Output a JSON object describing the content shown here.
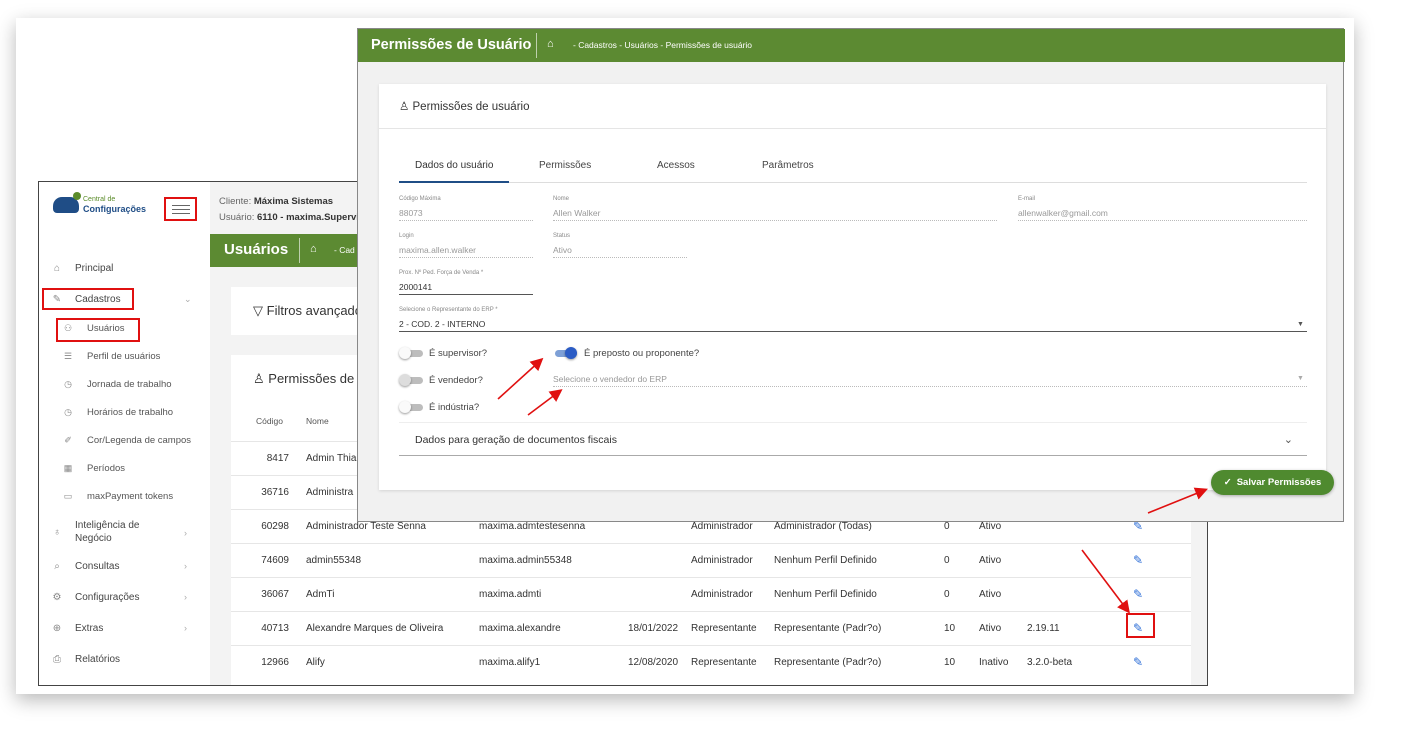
{
  "colors": {
    "green": "#5c8a32",
    "red_highlight": "#e01010",
    "toggle_on": "#2b5cc5",
    "save_button": "#4f8a2f",
    "edit_icon": "#2b6cd6"
  },
  "logo": {
    "small": "Central de",
    "big": "Configurações"
  },
  "client": {
    "client_label": "Cliente:",
    "client_value": "Máxima Sistemas",
    "user_label": "Usuário:",
    "user_value": "6110 - maxima.Supervis"
  },
  "bg_header": {
    "title": "Usuários",
    "breadcrumb": "- Cad"
  },
  "sidebar": {
    "items": [
      {
        "label": "Principal",
        "icon": "home-icon"
      },
      {
        "label": "Cadastros",
        "icon": "edit-note-icon"
      },
      {
        "label": "Inteligência de Negócio",
        "icon": "lightbulb-icon"
      },
      {
        "label": "Consultas",
        "icon": "search-icon"
      },
      {
        "label": "Configurações",
        "icon": "gear-icon"
      },
      {
        "label": "Extras",
        "icon": "plus-circle-icon"
      },
      {
        "label": "Relatórios",
        "icon": "printer-icon"
      }
    ],
    "sub_items": [
      {
        "label": "Usuários",
        "icon": "users-icon"
      },
      {
        "label": "Perfil de usuários",
        "icon": "list-icon"
      },
      {
        "label": "Jornada de trabalho",
        "icon": "clock-icon"
      },
      {
        "label": "Horários de trabalho",
        "icon": "clock-icon"
      },
      {
        "label": "Cor/Legenda de campos",
        "icon": "pen-icon"
      },
      {
        "label": "Períodos",
        "icon": "calendar-icon"
      },
      {
        "label": "maxPayment tokens",
        "icon": "card-icon"
      }
    ]
  },
  "filters": {
    "title": "Filtros avançado"
  },
  "perms_panel": {
    "title": "Permissões de u"
  },
  "table": {
    "headers": {
      "code": "Código",
      "name": "Nome"
    },
    "rows": [
      {
        "code": "8417",
        "name": "Admin Thia",
        "login": "",
        "date": "",
        "type": "",
        "profile": "",
        "n": "",
        "status": "",
        "version": ""
      },
      {
        "code": "36716",
        "name": "Administra",
        "login": "",
        "date": "",
        "type": "",
        "profile": "",
        "n": "",
        "status": "",
        "version": ""
      },
      {
        "code": "60298",
        "name": "Administrador Teste Senna",
        "login": "maxima.admtestesenna",
        "date": "",
        "type": "Administrador",
        "profile": "Administrador (Todas)",
        "n": "0",
        "status": "Ativo",
        "version": ""
      },
      {
        "code": "74609",
        "name": "admin55348",
        "login": "maxima.admin55348",
        "date": "",
        "type": "Administrador",
        "profile": "Nenhum Perfil Definido",
        "n": "0",
        "status": "Ativo",
        "version": ""
      },
      {
        "code": "36067",
        "name": "AdmTi",
        "login": "maxima.admti",
        "date": "",
        "type": "Administrador",
        "profile": "Nenhum Perfil Definido",
        "n": "0",
        "status": "Ativo",
        "version": ""
      },
      {
        "code": "40713",
        "name": "Alexandre Marques de Oliveira",
        "login": "maxima.alexandre",
        "date": "18/01/2022",
        "type": "Representante",
        "profile": "Representante (Padr?o)",
        "n": "10",
        "status": "Ativo",
        "version": "2.19.11"
      },
      {
        "code": "12966",
        "name": "Alify",
        "login": "maxima.alify1",
        "date": "12/08/2020",
        "type": "Representante",
        "profile": "Representante (Padr?o)",
        "n": "10",
        "status": "Inativo",
        "version": "3.2.0-beta"
      }
    ]
  },
  "dialog": {
    "title": "Permissões de Usuário",
    "breadcrumb": "- Cadastros - Usuários - Permissões de usuário",
    "card_title": "Permissões de usuário",
    "tabs": [
      "Dados do usuário",
      "Permissões",
      "Acessos",
      "Parâmetros"
    ],
    "fields": {
      "codigo_label": "Código Máxima",
      "codigo_value": "88073",
      "nome_label": "Nome",
      "nome_value": "Allen Walker",
      "email_label": "E-mail",
      "email_value": "allenwalker@gmail.com",
      "login_label": "Login",
      "login_value": "maxima.allen.walker",
      "status_label": "Status",
      "status_value": "Ativo",
      "prox_label": "Prox. Nº Ped. Força de Venda *",
      "prox_value": "2000141",
      "rep_label": "Selecione o Representante do ERP *",
      "rep_value": "2 - COD. 2 - INTERNO"
    },
    "toggles": [
      {
        "label": "É supervisor?",
        "on": false
      },
      {
        "label": "É preposto ou proponente?",
        "on": true
      },
      {
        "label": "É vendedor?",
        "on": false
      },
      {
        "label": "É indústria?",
        "on": false
      }
    ],
    "vendor_placeholder": "Selecione o vendedor do ERP",
    "accordion": "Dados para geração de documentos fiscais",
    "save_label": "Salvar Permissões"
  }
}
